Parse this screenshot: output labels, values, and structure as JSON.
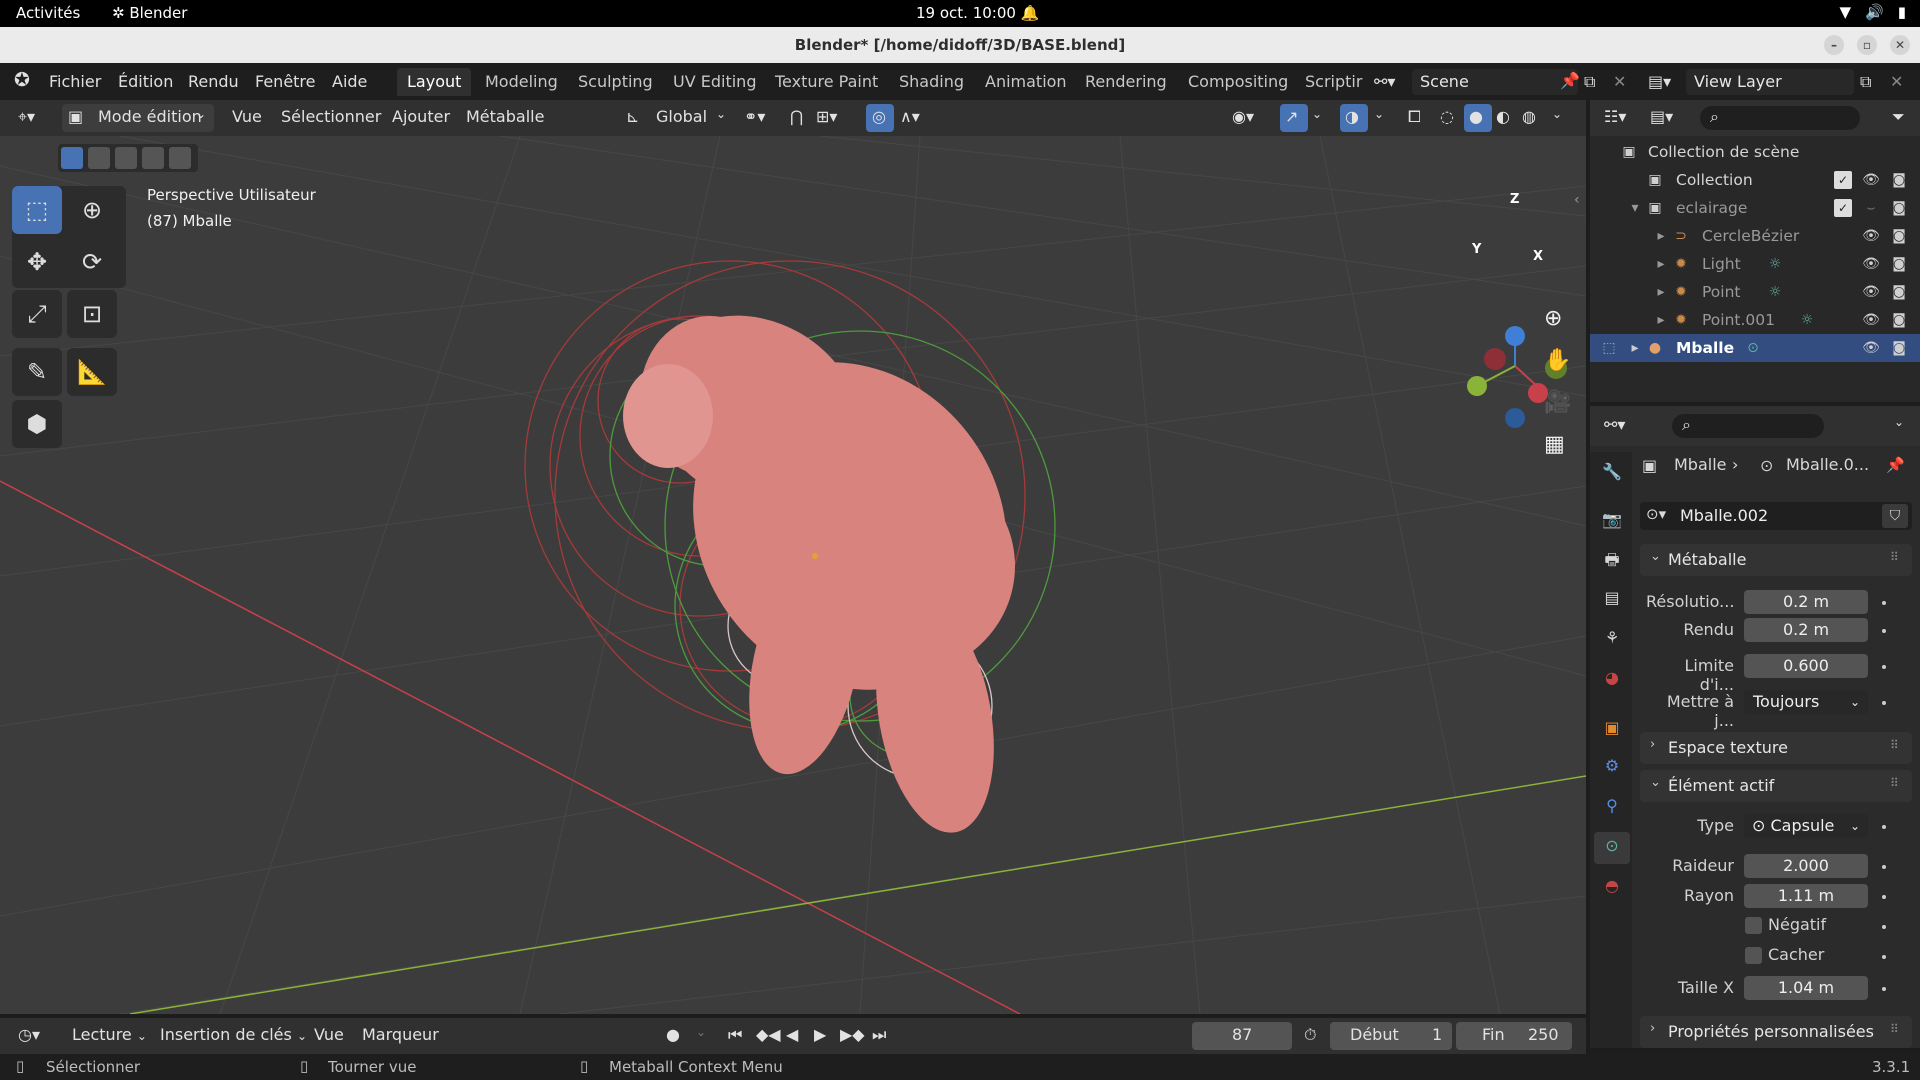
{
  "gnome": {
    "activities": "Activités",
    "app": "Blender",
    "clock": "19 oct.  10:00"
  },
  "window": {
    "title": "Blender* [/home/didoff/3D/BASE.blend]"
  },
  "menu": {
    "fichier": "Fichier",
    "edition": "Édition",
    "rendu": "Rendu",
    "fenetre": "Fenêtre",
    "aide": "Aide"
  },
  "workspaces": [
    "Layout",
    "Modeling",
    "Sculpting",
    "UV Editing",
    "Texture Paint",
    "Shading",
    "Animation",
    "Rendering",
    "Compositing",
    "Scriptir"
  ],
  "scene": {
    "name": "Scene",
    "view_layer": "View Layer"
  },
  "viewport_header": {
    "mode": "Mode édition",
    "vue": "Vue",
    "select": "Sélectionner",
    "add": "Ajouter",
    "metaball": "Métaballe",
    "orientation": "Global"
  },
  "viewport": {
    "perspective": "Perspective Utilisateur",
    "object": "(87) Mballe"
  },
  "gizmo": {
    "z": "Z",
    "y": "Y",
    "x": "X"
  },
  "outliner": {
    "scene_collection": "Collection de scène",
    "items": [
      {
        "label": "Collection"
      },
      {
        "label": "eclairage"
      },
      {
        "label": "CercleBézier"
      },
      {
        "label": "Light"
      },
      {
        "label": "Point"
      },
      {
        "label": "Point.001"
      },
      {
        "label": "Mballe"
      }
    ]
  },
  "properties": {
    "breadcrumb_obj": "Mballe",
    "breadcrumb_data": "Mballe.0...",
    "datablock": "Mballe.002",
    "metaball_panel": "Métaballe",
    "resolution_label": "Résolutio...",
    "resolution_value": "0.2 m",
    "render_label": "Rendu",
    "render_value": "0.2 m",
    "threshold_label": "Limite d'i...",
    "threshold_value": "0.600",
    "update_label": "Mettre à j...",
    "update_value": "Toujours",
    "texture_space": "Espace texture",
    "active_element": "Élément actif",
    "type_label": "Type",
    "type_value": "Capsule",
    "stiffness_label": "Raideur",
    "stiffness_value": "2.000",
    "radius_label": "Rayon",
    "radius_value": "1.11 m",
    "negative_label": "Négatif",
    "hide_label": "Cacher",
    "size_x_label": "Taille X",
    "size_x_value": "1.04 m",
    "custom_props": "Propriétés personnalisées"
  },
  "timeline": {
    "playback": "Lecture",
    "keying": "Insertion de clés",
    "view": "Vue",
    "marker": "Marqueur",
    "frame": "87",
    "start_label": "Début",
    "start": "1",
    "end_label": "Fin",
    "end": "250"
  },
  "status": {
    "select": "Sélectionner",
    "rotate": "Tourner vue",
    "context": "Metaball Context Menu",
    "version": "3.3.1"
  },
  "colors": {
    "accent": "#4772b3",
    "selection": "#334d80",
    "mesh": "#d9837f",
    "x_axis": "#c8404a",
    "y_axis": "#8ab339",
    "z_axis": "#3f7fd6"
  }
}
